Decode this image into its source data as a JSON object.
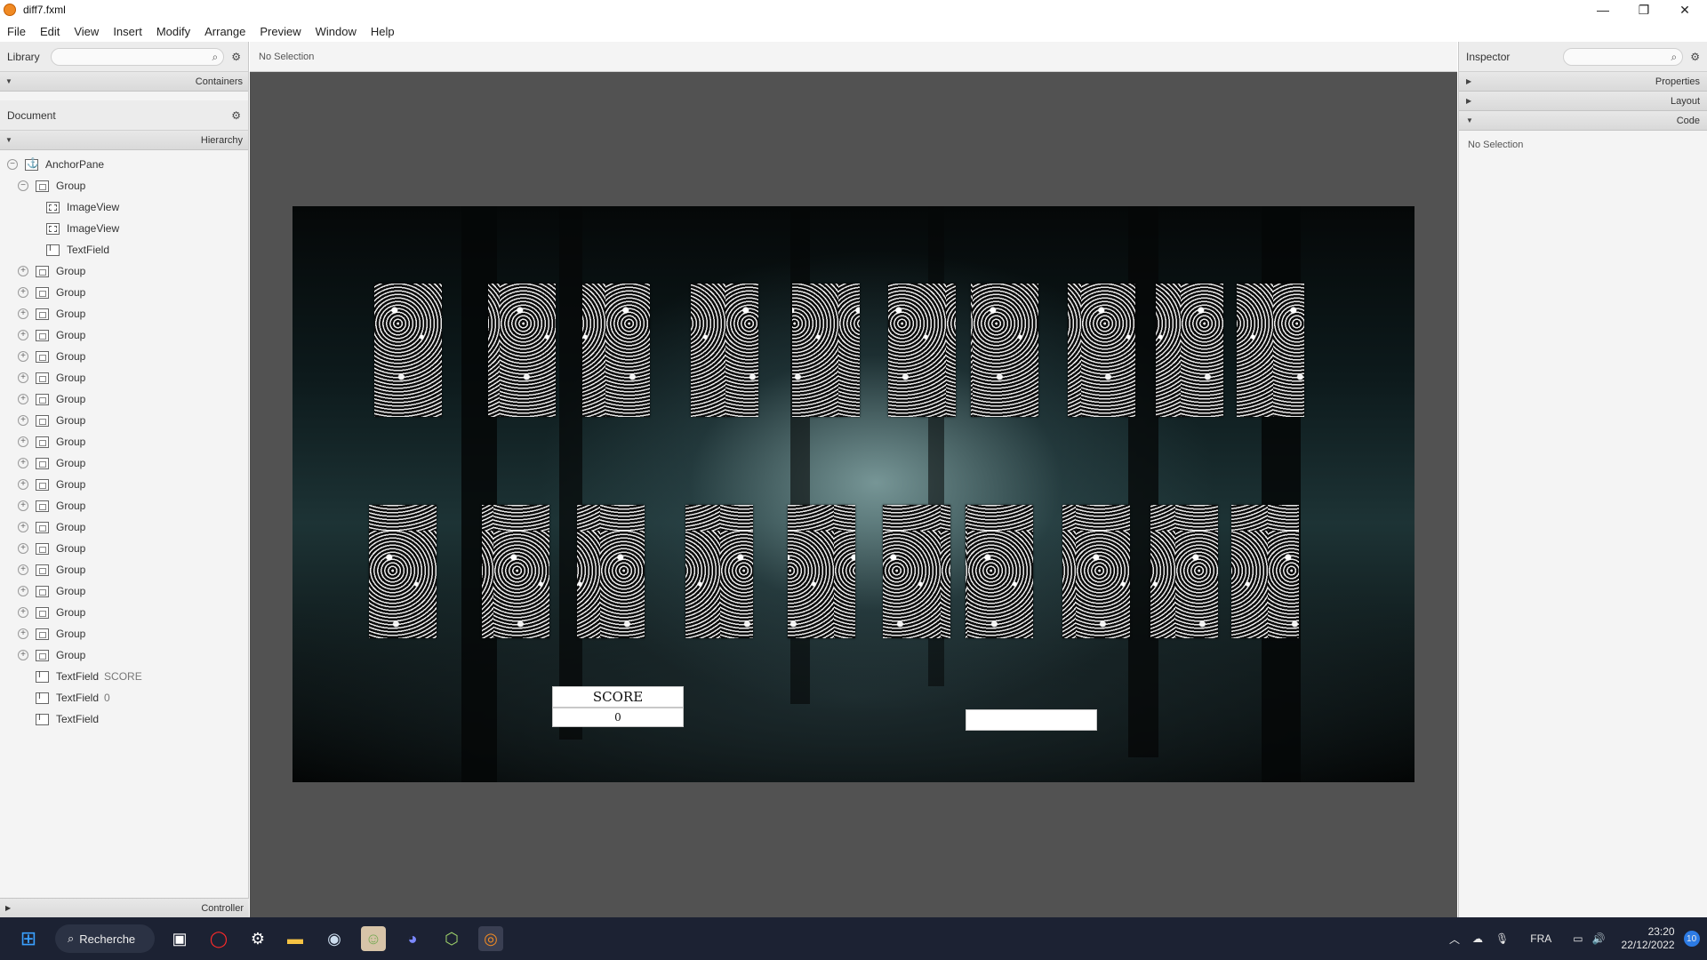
{
  "window": {
    "title": "diff7.fxml"
  },
  "menu": [
    "File",
    "Edit",
    "View",
    "Insert",
    "Modify",
    "Arrange",
    "Preview",
    "Window",
    "Help"
  ],
  "library": {
    "label": "Library",
    "section": "Containers"
  },
  "document": {
    "label": "Document",
    "section": "Hierarchy",
    "controller": "Controller",
    "tree": [
      {
        "name": "AnchorPane",
        "type": "anchor",
        "indent": 0,
        "expander": "−",
        "extra": ""
      },
      {
        "name": "Group",
        "type": "group",
        "indent": 1,
        "expander": "−",
        "extra": ""
      },
      {
        "name": "ImageView",
        "type": "image",
        "indent": 2,
        "expander": "",
        "extra": ""
      },
      {
        "name": "ImageView",
        "type": "image",
        "indent": 2,
        "expander": "",
        "extra": ""
      },
      {
        "name": "TextField",
        "type": "text",
        "indent": 2,
        "expander": "",
        "extra": ""
      },
      {
        "name": "Group",
        "type": "group",
        "indent": 1,
        "expander": "+",
        "extra": ""
      },
      {
        "name": "Group",
        "type": "group",
        "indent": 1,
        "expander": "+",
        "extra": ""
      },
      {
        "name": "Group",
        "type": "group",
        "indent": 1,
        "expander": "+",
        "extra": ""
      },
      {
        "name": "Group",
        "type": "group",
        "indent": 1,
        "expander": "+",
        "extra": ""
      },
      {
        "name": "Group",
        "type": "group",
        "indent": 1,
        "expander": "+",
        "extra": ""
      },
      {
        "name": "Group",
        "type": "group",
        "indent": 1,
        "expander": "+",
        "extra": ""
      },
      {
        "name": "Group",
        "type": "group",
        "indent": 1,
        "expander": "+",
        "extra": ""
      },
      {
        "name": "Group",
        "type": "group",
        "indent": 1,
        "expander": "+",
        "extra": ""
      },
      {
        "name": "Group",
        "type": "group",
        "indent": 1,
        "expander": "+",
        "extra": ""
      },
      {
        "name": "Group",
        "type": "group",
        "indent": 1,
        "expander": "+",
        "extra": ""
      },
      {
        "name": "Group",
        "type": "group",
        "indent": 1,
        "expander": "+",
        "extra": ""
      },
      {
        "name": "Group",
        "type": "group",
        "indent": 1,
        "expander": "+",
        "extra": ""
      },
      {
        "name": "Group",
        "type": "group",
        "indent": 1,
        "expander": "+",
        "extra": ""
      },
      {
        "name": "Group",
        "type": "group",
        "indent": 1,
        "expander": "+",
        "extra": ""
      },
      {
        "name": "Group",
        "type": "group",
        "indent": 1,
        "expander": "+",
        "extra": ""
      },
      {
        "name": "Group",
        "type": "group",
        "indent": 1,
        "expander": "+",
        "extra": ""
      },
      {
        "name": "Group",
        "type": "group",
        "indent": 1,
        "expander": "+",
        "extra": ""
      },
      {
        "name": "Group",
        "type": "group",
        "indent": 1,
        "expander": "+",
        "extra": ""
      },
      {
        "name": "Group",
        "type": "group",
        "indent": 1,
        "expander": "+",
        "extra": ""
      },
      {
        "name": "TextField",
        "type": "text",
        "indent": 1,
        "expander": "",
        "extra": "SCORE"
      },
      {
        "name": "TextField",
        "type": "text",
        "indent": 1,
        "expander": "",
        "extra": "0"
      },
      {
        "name": "TextField",
        "type": "text",
        "indent": 1,
        "expander": "",
        "extra": ""
      }
    ]
  },
  "center": {
    "selection": "No Selection"
  },
  "scene": {
    "score_label": "SCORE",
    "score_value": "0",
    "empty_field": "",
    "card_rows": 2,
    "cards_per_row": 10
  },
  "inspector": {
    "label": "Inspector",
    "sections": [
      "Properties",
      "Layout",
      "Code"
    ],
    "selection": "No Selection"
  },
  "taskbar": {
    "search": "Recherche",
    "apps": [
      "start-icon",
      "task-view-icon",
      "opera-icon",
      "steelseries-icon",
      "file-explorer-icon",
      "steam-icon",
      "game-character-icon",
      "discord-icon",
      "shield-app-icon",
      "scene-builder-icon"
    ],
    "language": "FRA",
    "time": "23:20",
    "date": "22/12/2022",
    "notifications": "10"
  }
}
